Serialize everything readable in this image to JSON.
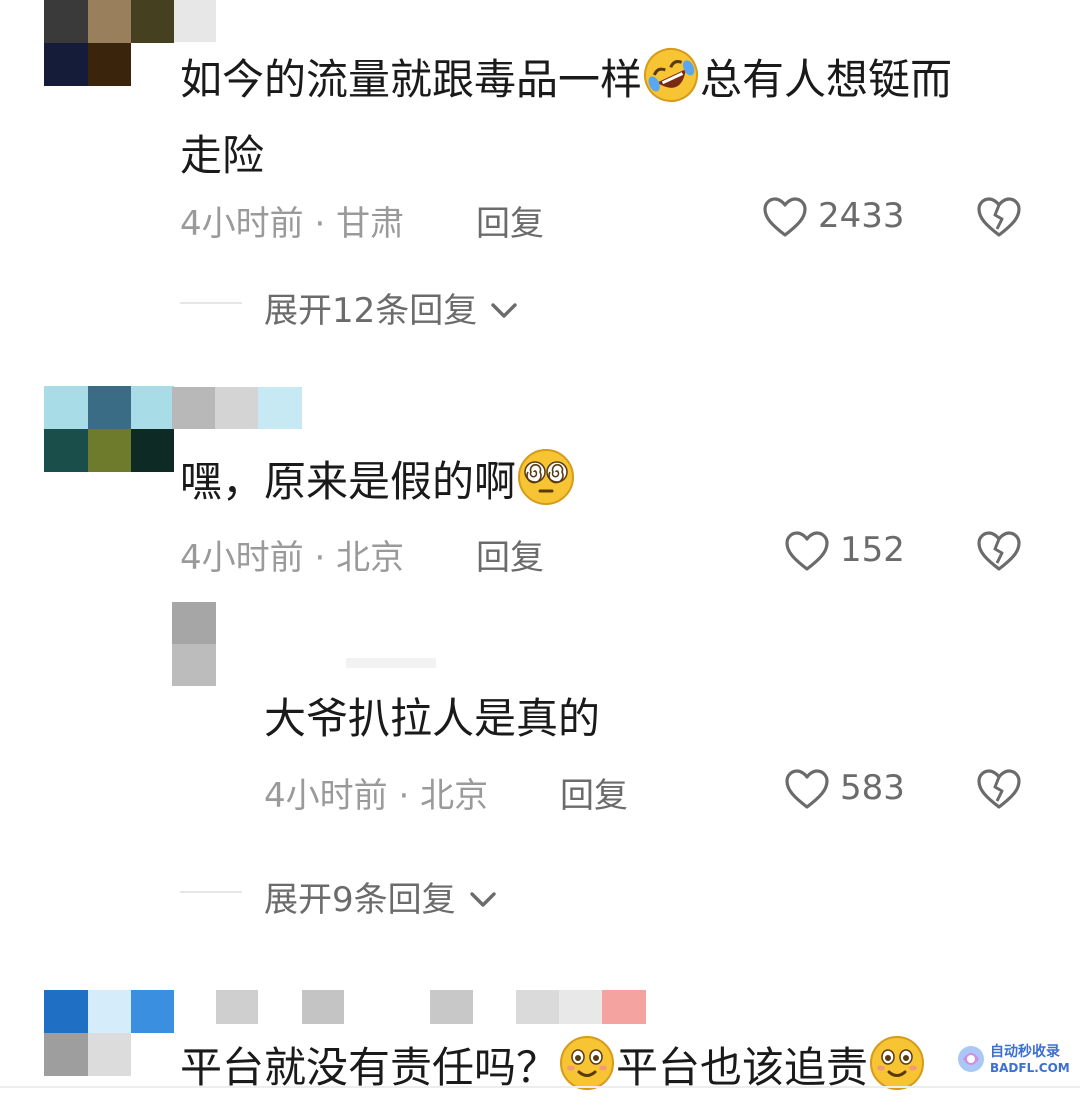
{
  "comments": [
    {
      "text_a": "如今的流量就跟毒品一样",
      "emoji_a": "rofl-emoji",
      "text_b": "总有人想铤而",
      "text_line2": "走险",
      "time": "4小时前",
      "location": "甘肃",
      "reply_label": "回复",
      "likes": "2433",
      "expand_label": "展开12条回复"
    },
    {
      "text_a": "嘿，原来是假的啊",
      "emoji_a": "dizzy-eyes-emoji",
      "time": "4小时前",
      "location": "北京",
      "reply_label": "回复",
      "likes": "152",
      "reply": {
        "text": "大爷扒拉人是真的",
        "time": "4小时前",
        "location": "北京",
        "reply_label": "回复",
        "likes": "583"
      },
      "expand_label": "展开9条回复"
    },
    {
      "text_a": "平台就没有责任吗？",
      "emoji_a": "smile-emoji",
      "text_b": "平台也该追责",
      "emoji_b": "smile-emoji"
    }
  ],
  "meta_separator": " · ",
  "watermark": {
    "line1": "自动秒收录",
    "line2": "BADFL.COM"
  },
  "colors": {
    "text": "#1a1a1a",
    "meta": "#9a9a9a",
    "secondary": "#6b6b6b",
    "emoji_yellow": "#f7c533"
  }
}
